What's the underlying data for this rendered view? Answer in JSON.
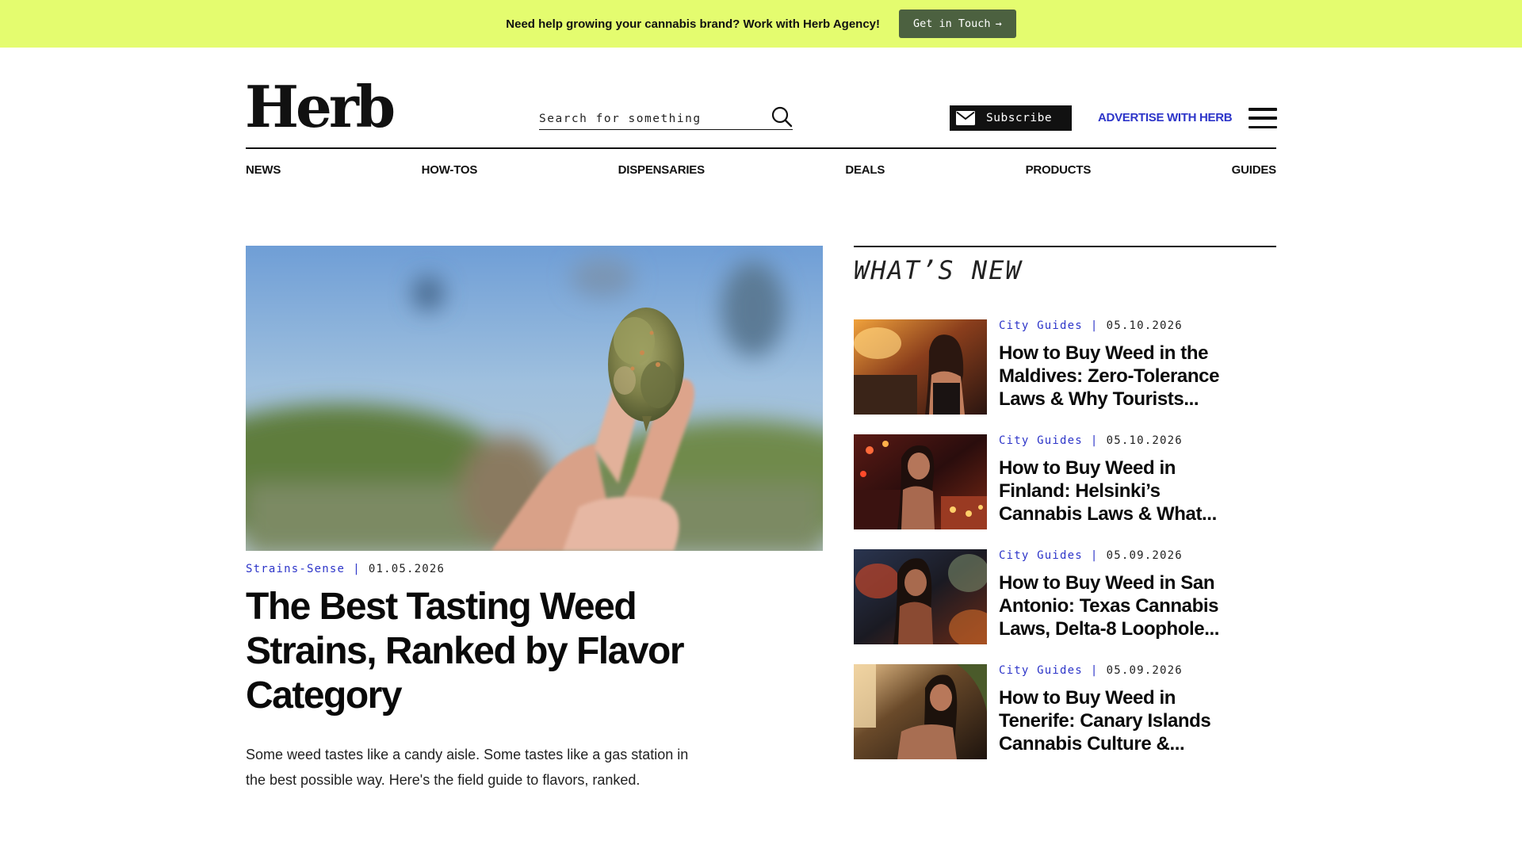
{
  "promo": {
    "text": "Need help growing your cannabis brand? Work with Herb Agency!",
    "button_label": "Get in Touch",
    "button_arrow": "→",
    "background": "#e4fc6f",
    "button_color": "#4c6140"
  },
  "header": {
    "logo": "Herb",
    "search_placeholder": "Search for something",
    "subscribe_label": "Subscribe",
    "advertise_label": "ADVERTISE WITH HERB",
    "accent": "#2d35c9"
  },
  "nav": [
    "NEWS",
    "HOW-TOS",
    "DISPENSARIES",
    "DEALS",
    "PRODUCTS",
    "GUIDES"
  ],
  "feature": {
    "category": "Strains-Sense",
    "separator": "|",
    "date": "01.05.2026",
    "title": "The Best Tasting Weed Strains, Ranked by Flavor Category",
    "description": "Some weed tastes like a candy aisle. Some tastes like a gas station in the best possible way. Here's the field guide to flavors, ranked."
  },
  "whats_new": {
    "heading": "WHAT’S NEW",
    "items": [
      {
        "category": "City Guides",
        "separator": "|",
        "date": "05.10.2026",
        "title": "How to Buy Weed in the Maldives: Zero-Tolerance Laws & Why Tourists..."
      },
      {
        "category": "City Guides",
        "separator": "|",
        "date": "05.10.2026",
        "title": "How to Buy Weed in Finland: Helsinki’s Cannabis Laws & What..."
      },
      {
        "category": "City Guides",
        "separator": "|",
        "date": "05.09.2026",
        "title": "How to Buy Weed in San Antonio: Texas Cannabis Laws, Delta-8 Loophole..."
      },
      {
        "category": "City Guides",
        "separator": "|",
        "date": "05.09.2026",
        "title": "How to Buy Weed in Tenerife: Canary Islands Cannabis Culture &..."
      }
    ]
  }
}
